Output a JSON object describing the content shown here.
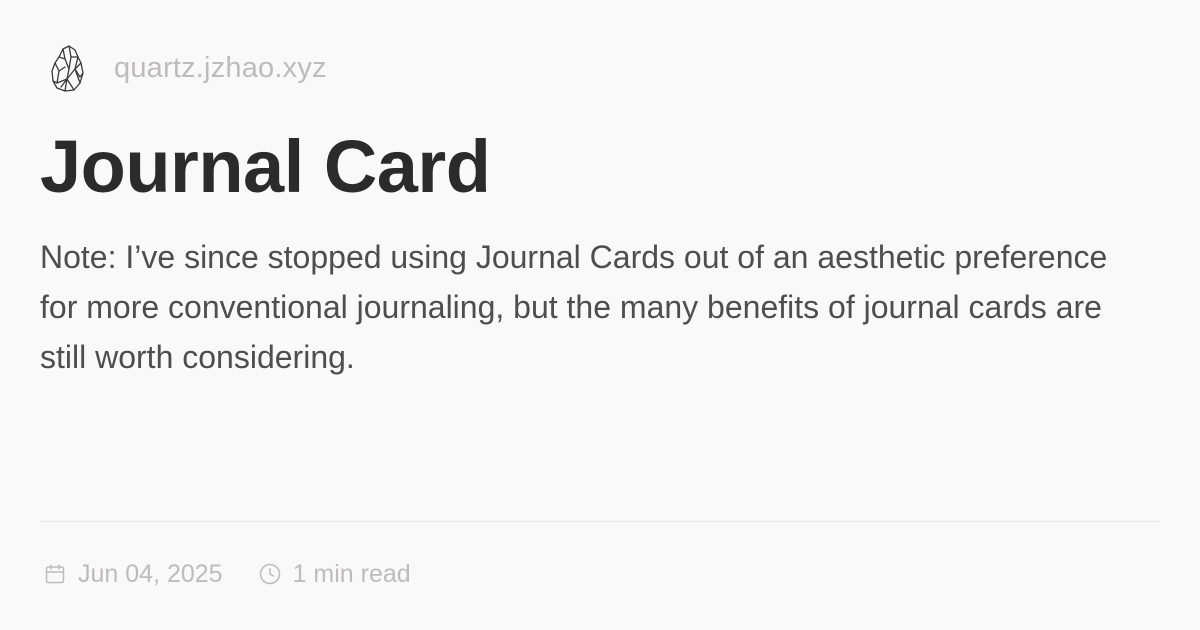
{
  "site": {
    "logo_icon": "crystal-icon",
    "name": "quartz.jzhao.xyz"
  },
  "page": {
    "title": "Journal Card",
    "description": "Note: I’ve since stopped using Journal Cards out of an aesthetic preference for more conventional journaling, but the many benefits of journal cards are still worth considering."
  },
  "meta": {
    "date_icon": "calendar-icon",
    "date": "Jun 04, 2025",
    "reading_time_icon": "clock-icon",
    "reading_time": "1 min read"
  },
  "colors": {
    "background": "#faf9f9",
    "title": "#2b2b2b",
    "body_text": "#4e4e4e",
    "muted_text": "#bdbbbb",
    "divider": "#e7e5e5"
  }
}
